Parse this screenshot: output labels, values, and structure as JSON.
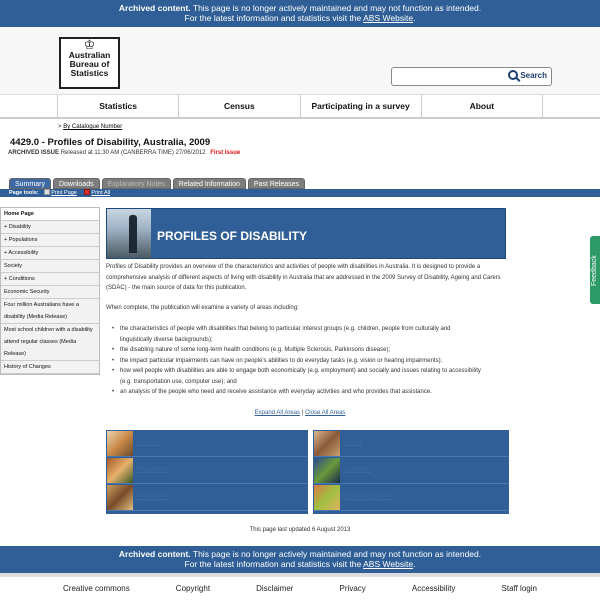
{
  "archived_notice": {
    "bold": "Archived content.",
    "line1": " This page is no longer actively maintained and may not function as intended.",
    "line2_pre": "For the latest information and statistics visit the ",
    "link": "ABS Website",
    "line2_post": "."
  },
  "logo": {
    "line1": "Australian",
    "line2": "Bureau of",
    "line3": "Statistics"
  },
  "search": {
    "button_label": "Search",
    "placeholder": ""
  },
  "nav": [
    "Statistics",
    "Census",
    "Participating in a survey",
    "About"
  ],
  "breadcrumb": {
    "prefix": ">",
    "link": "By Catalogue Number"
  },
  "page_title": "4429.0 - Profiles of Disability, Australia, 2009",
  "issue": {
    "label": "ARCHIVED ISSUE",
    "released": "Released at 11:30 AM (CANBERRA TIME) 27/06/2012",
    "first_issue": "First Issue"
  },
  "tabs": [
    {
      "label": "Summary",
      "state": "active"
    },
    {
      "label": "Downloads",
      "state": "normal"
    },
    {
      "label": "Explanatory Notes",
      "state": "disabled"
    },
    {
      "label": "Related Information",
      "state": "normal"
    },
    {
      "label": "Past Releases",
      "state": "normal"
    }
  ],
  "page_tools": {
    "label": "Page tools:",
    "print_page": "Print Page",
    "print_all": "Print All"
  },
  "sidebar": [
    "Home Page",
    "+ Disability",
    "+ Populations",
    "+ Accessibility",
    "Society",
    "+ Conditions",
    "Economic Security",
    "Four million Australians have a disability (Media Release)",
    "Most school children with a disability attend regular classes (Media Release)",
    "History of Changes"
  ],
  "banner_title": "PROFILES OF DISABILITY",
  "intro": "Profiles of Disability provides an overview of the characteristics and activities of people with disabilities in Australia. It is designed to provide a comprehensive analysis of different aspects of living with disability in Australia that are addressed in the 2009 Survey of Disability, Ageing and Carers (SDAC) - the main source of data for this publication.",
  "when_complete": "When complete, the publication will examine a variety of areas including:",
  "bullets": [
    "the characteristics of people with disabilities that belong to particular interest groups (e.g. children, people from culturally and linguistically diverse backgrounds);",
    "the disabling nature of some long-term health conditions (e.g. Multiple Sclerosis, Parkinsons disease);",
    "the impact particular impairments can have on people's abilities to do everyday tasks (e.g. vision or hearing impairments);",
    "how well people with disabilities are able to engage both economically (e.g. employment) and socially and issues relating to accessibility (e.g. transportation use, computer use); and",
    "an analysis of the people who need and receive assistance with everyday activities and who provides that assistance."
  ],
  "expand_all": "Expand All Areas",
  "separator": "|",
  "close_all": "Close All Areas",
  "feature_links_left": [
    "Disability",
    "Populations",
    "Accessibility"
  ],
  "feature_links_right": [
    "Society",
    "Conditions",
    "Economic Security"
  ],
  "updated": "This page last updated 6 August 2013",
  "footer": [
    "Creative commons",
    "Copyright",
    "Disclaimer",
    "Privacy",
    "Accessibility",
    "Staff login"
  ],
  "feedback": "Feedback",
  "colors": {
    "primary_blue": "#2f5f96",
    "first_issue_red": "#dd1111",
    "feedback_green": "#2e9a66"
  }
}
